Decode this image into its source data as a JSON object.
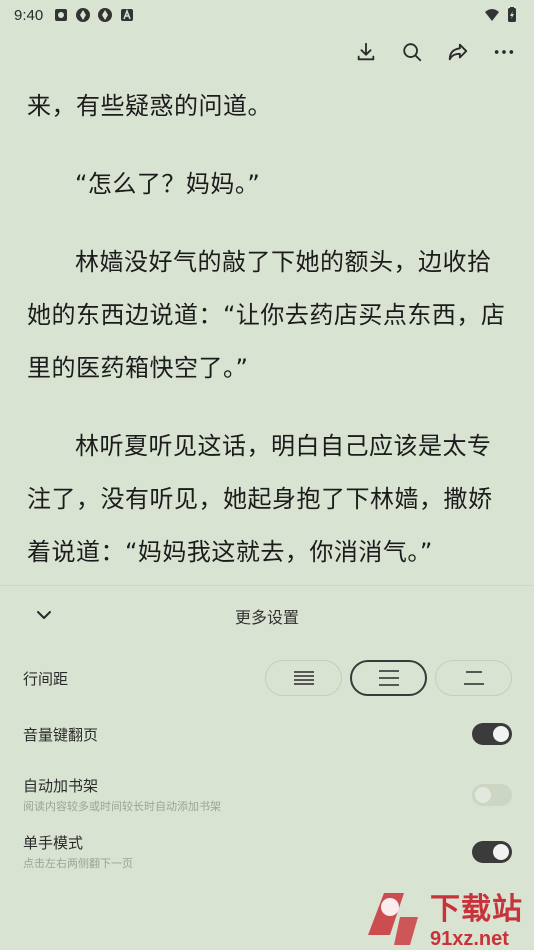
{
  "status_bar": {
    "time": "9:40",
    "icons": [
      "sim-icon",
      "app-icon-1",
      "app-icon-2",
      "a-icon"
    ],
    "right_icons": [
      "wifi-icon",
      "battery-icon"
    ]
  },
  "toolbar": {
    "buttons": [
      "download-icon",
      "search-icon",
      "share-icon",
      "more-icon"
    ]
  },
  "content": {
    "paragraphs": [
      "来，有些疑惑的问道。",
      "“怎么了？妈妈。”",
      "林嫱没好气的敲了下她的额头，边收拾她的东西边说道：“让你去药店买点东西，店里的医药箱快空了。”",
      "林听夏听见这话，明白自己应该是太专注了，没有听见，她起身抱了下林嫱，撒娇着说道：“妈妈我这就去，你消消气。”"
    ]
  },
  "panel": {
    "title": "更多设置",
    "line_spacing_label": "行间距",
    "line_spacing_options": [
      "dense",
      "medium",
      "loose"
    ],
    "line_spacing_selected": "medium",
    "volume_key_label": "音量键翻页",
    "volume_key_on": true,
    "auto_shelf_label": "自动加书架",
    "auto_shelf_desc": "阅读内容较多或时间较长时自动添加书架",
    "auto_shelf_on": false,
    "one_hand_label": "单手模式",
    "one_hand_desc": "点击左右两侧翻下一页",
    "one_hand_on": true
  },
  "watermark": {
    "top": "下载站",
    "bottom": "91xz.net",
    "logo": "9f"
  },
  "colors": {
    "background": "#d9e3d2",
    "toggle_on": "#3b3b3b",
    "watermark": "#c8323a"
  }
}
